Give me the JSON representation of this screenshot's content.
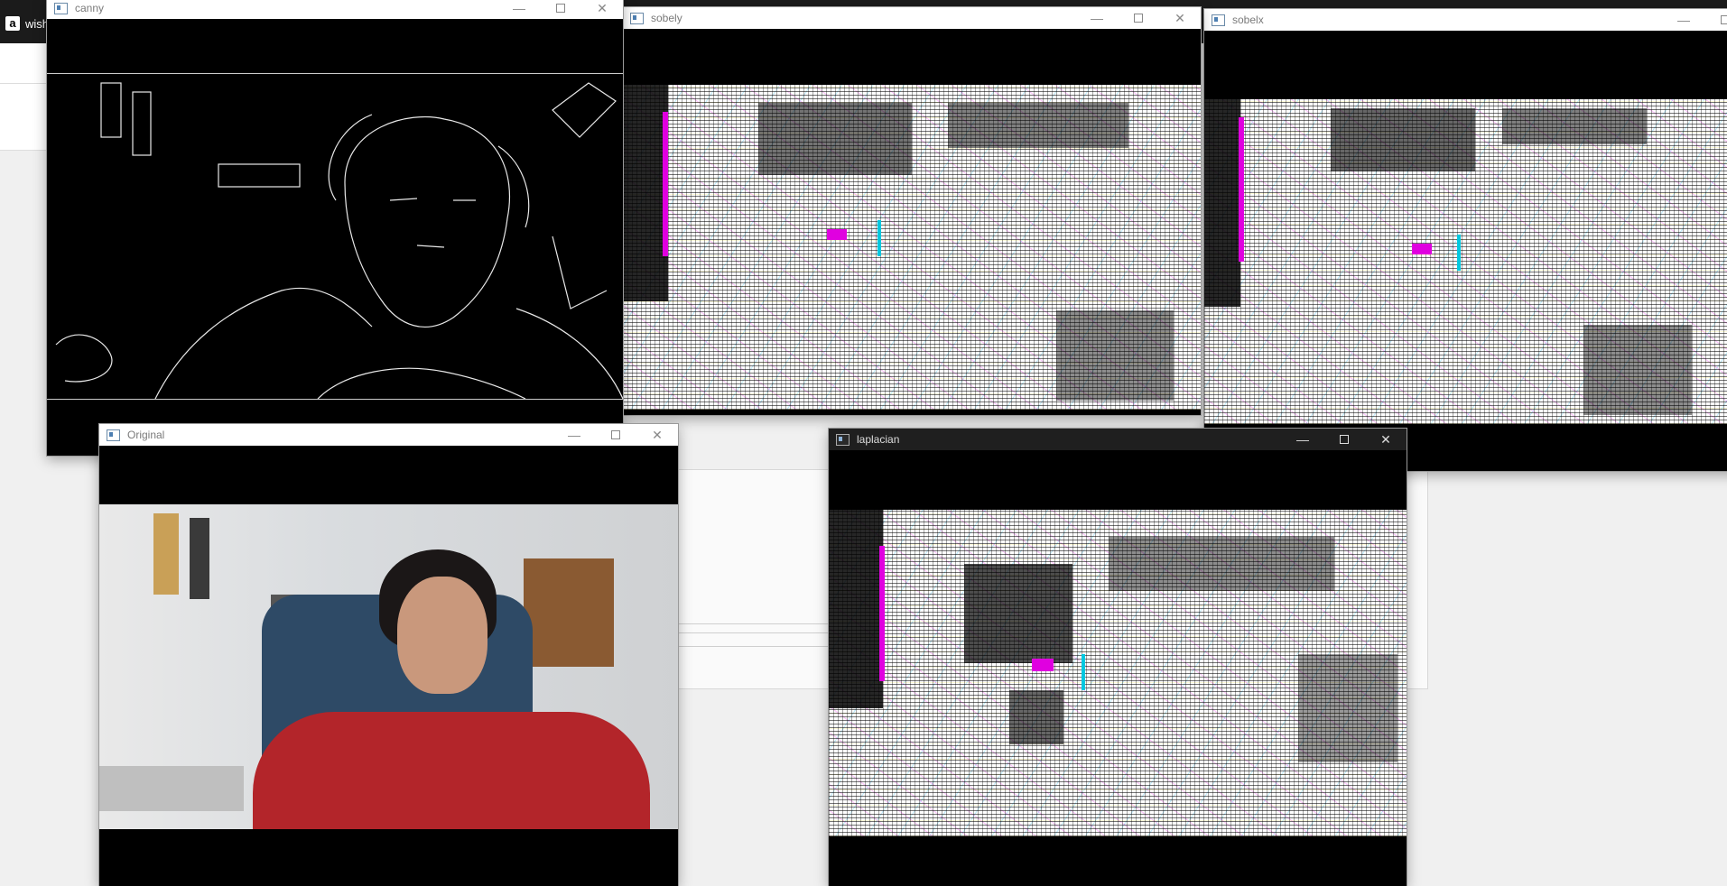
{
  "background_app": {
    "tab_icon": "a",
    "tab_label": "wish"
  },
  "windows": {
    "canny": {
      "title": "canny"
    },
    "sobely": {
      "title": "sobely"
    },
    "sobelx": {
      "title": "sobelx"
    },
    "original": {
      "title": "Original"
    },
    "laplacian": {
      "title": "laplacian"
    }
  },
  "controls": {
    "minimize": "—",
    "close": "✕"
  },
  "icons": [
    "app-window-icon",
    "minimize-icon",
    "maximize-icon",
    "close-icon",
    "amazon-icon"
  ],
  "colors": {
    "titlebar_light": "#ffffff",
    "titlebar_dark": "#1f1f1f",
    "desktop": "#f0f0f0"
  }
}
